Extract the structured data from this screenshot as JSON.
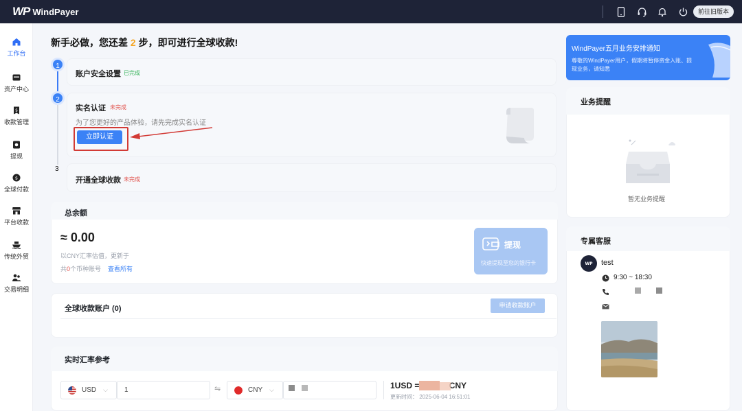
{
  "app": {
    "logo_mark": "WP",
    "logo_text": "WindPayer"
  },
  "topbar": {
    "old_version_label": "前往旧版本"
  },
  "sidebar": {
    "items": [
      {
        "label": "工作台",
        "icon": "home-icon",
        "active": true
      },
      {
        "label": "资产中心",
        "icon": "wallet-icon"
      },
      {
        "label": "收款管理",
        "icon": "receive-icon"
      },
      {
        "label": "提现",
        "icon": "withdraw-icon"
      },
      {
        "label": "全球付款",
        "icon": "global-pay-icon"
      },
      {
        "label": "平台收款",
        "icon": "store-icon"
      },
      {
        "label": "传统外贸",
        "icon": "ship-icon"
      },
      {
        "label": "交易明细",
        "icon": "users-icon"
      }
    ]
  },
  "onboarding": {
    "title_prefix": "新手必做，您还差 ",
    "remaining": "2",
    "title_suffix": " 步，即可进行全球收款!",
    "steps": [
      {
        "number": "1",
        "title": "账户安全设置",
        "status": "已完成"
      },
      {
        "number": "2",
        "title": "实名认证",
        "status": "未完成",
        "desc": "为了您更好的产品体验，请先完成实名认证",
        "button": "立即认证"
      },
      {
        "number": "3",
        "title": "开通全球收款",
        "status": "未完成"
      }
    ]
  },
  "balance": {
    "title": "总余额",
    "value": "≈ 0.00",
    "note": "以CNY汇率估值，更新于",
    "accounts_prefix": "共",
    "accounts_count": "0",
    "accounts_suffix": "个币种账号",
    "view_all": "查看所有",
    "withdraw": {
      "title": "提现",
      "subtitle": "快速提现至您的银行卡"
    }
  },
  "global_accounts": {
    "title": "全球收款账户 (0)",
    "apply_button": "申请收款账户"
  },
  "exchange": {
    "title": "实时汇率参考",
    "from_currency": "USD",
    "amount": "1",
    "to_currency": "CNY",
    "result_prefix": "1USD =",
    "result_suffix": "CNY",
    "update_time": "更新时间： 2025-06-04 16:51:01"
  },
  "notice": {
    "title": "WindPayer五月业务安排通知",
    "text": "尊敬的WindPayer用户，假期将暂停资金入账、提现业务，请知悉"
  },
  "reminders": {
    "title": "业务提醒",
    "empty": "暂无业务提醒"
  },
  "service": {
    "title": "专属客服",
    "name": "test",
    "hours": "9:30 ~ 18:30"
  },
  "colors": {
    "primary": "#3b82f6",
    "topbar": "#1e2337",
    "annotation": "#d23a35"
  }
}
